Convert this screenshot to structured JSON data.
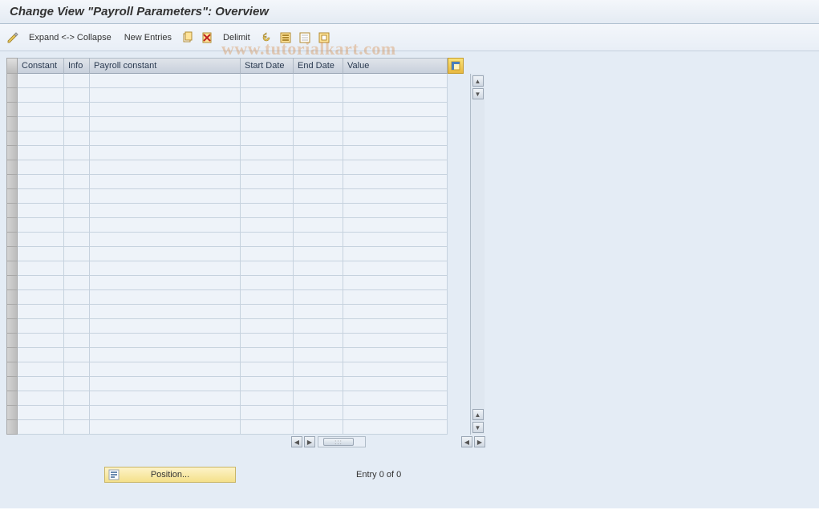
{
  "title": "Change View \"Payroll Parameters\": Overview",
  "toolbar": {
    "expand_collapse": "Expand <-> Collapse",
    "new_entries": "New Entries",
    "delimit": "Delimit"
  },
  "columns": {
    "constant": "Constant",
    "info": "Info",
    "payroll_constant": "Payroll constant",
    "start_date": "Start Date",
    "end_date": "End Date",
    "value": "Value"
  },
  "rows": [
    {
      "constant": "",
      "info": "",
      "payroll_constant": "",
      "start_date": "",
      "end_date": "",
      "value": ""
    },
    {
      "constant": "",
      "info": "",
      "payroll_constant": "",
      "start_date": "",
      "end_date": "",
      "value": ""
    },
    {
      "constant": "",
      "info": "",
      "payroll_constant": "",
      "start_date": "",
      "end_date": "",
      "value": ""
    },
    {
      "constant": "",
      "info": "",
      "payroll_constant": "",
      "start_date": "",
      "end_date": "",
      "value": ""
    },
    {
      "constant": "",
      "info": "",
      "payroll_constant": "",
      "start_date": "",
      "end_date": "",
      "value": ""
    },
    {
      "constant": "",
      "info": "",
      "payroll_constant": "",
      "start_date": "",
      "end_date": "",
      "value": ""
    },
    {
      "constant": "",
      "info": "",
      "payroll_constant": "",
      "start_date": "",
      "end_date": "",
      "value": ""
    },
    {
      "constant": "",
      "info": "",
      "payroll_constant": "",
      "start_date": "",
      "end_date": "",
      "value": ""
    },
    {
      "constant": "",
      "info": "",
      "payroll_constant": "",
      "start_date": "",
      "end_date": "",
      "value": ""
    },
    {
      "constant": "",
      "info": "",
      "payroll_constant": "",
      "start_date": "",
      "end_date": "",
      "value": ""
    },
    {
      "constant": "",
      "info": "",
      "payroll_constant": "",
      "start_date": "",
      "end_date": "",
      "value": ""
    },
    {
      "constant": "",
      "info": "",
      "payroll_constant": "",
      "start_date": "",
      "end_date": "",
      "value": ""
    },
    {
      "constant": "",
      "info": "",
      "payroll_constant": "",
      "start_date": "",
      "end_date": "",
      "value": ""
    },
    {
      "constant": "",
      "info": "",
      "payroll_constant": "",
      "start_date": "",
      "end_date": "",
      "value": ""
    },
    {
      "constant": "",
      "info": "",
      "payroll_constant": "",
      "start_date": "",
      "end_date": "",
      "value": ""
    },
    {
      "constant": "",
      "info": "",
      "payroll_constant": "",
      "start_date": "",
      "end_date": "",
      "value": ""
    },
    {
      "constant": "",
      "info": "",
      "payroll_constant": "",
      "start_date": "",
      "end_date": "",
      "value": ""
    },
    {
      "constant": "",
      "info": "",
      "payroll_constant": "",
      "start_date": "",
      "end_date": "",
      "value": ""
    },
    {
      "constant": "",
      "info": "",
      "payroll_constant": "",
      "start_date": "",
      "end_date": "",
      "value": ""
    },
    {
      "constant": "",
      "info": "",
      "payroll_constant": "",
      "start_date": "",
      "end_date": "",
      "value": ""
    },
    {
      "constant": "",
      "info": "",
      "payroll_constant": "",
      "start_date": "",
      "end_date": "",
      "value": ""
    },
    {
      "constant": "",
      "info": "",
      "payroll_constant": "",
      "start_date": "",
      "end_date": "",
      "value": ""
    },
    {
      "constant": "",
      "info": "",
      "payroll_constant": "",
      "start_date": "",
      "end_date": "",
      "value": ""
    },
    {
      "constant": "",
      "info": "",
      "payroll_constant": "",
      "start_date": "",
      "end_date": "",
      "value": ""
    },
    {
      "constant": "",
      "info": "",
      "payroll_constant": "",
      "start_date": "",
      "end_date": "",
      "value": ""
    }
  ],
  "footer": {
    "position_label": "Position...",
    "entry_text": "Entry 0 of 0"
  },
  "watermark": "www.tutorialkart.com",
  "icons": {
    "pencil": "pencil-icon",
    "copy": "copy-icon",
    "delete": "delete-icon",
    "undo": "undo-icon",
    "select_all": "select-all-icon",
    "deselect_all": "deselect-all-icon",
    "print": "print-icon",
    "config": "table-config-icon",
    "position": "position-icon"
  }
}
